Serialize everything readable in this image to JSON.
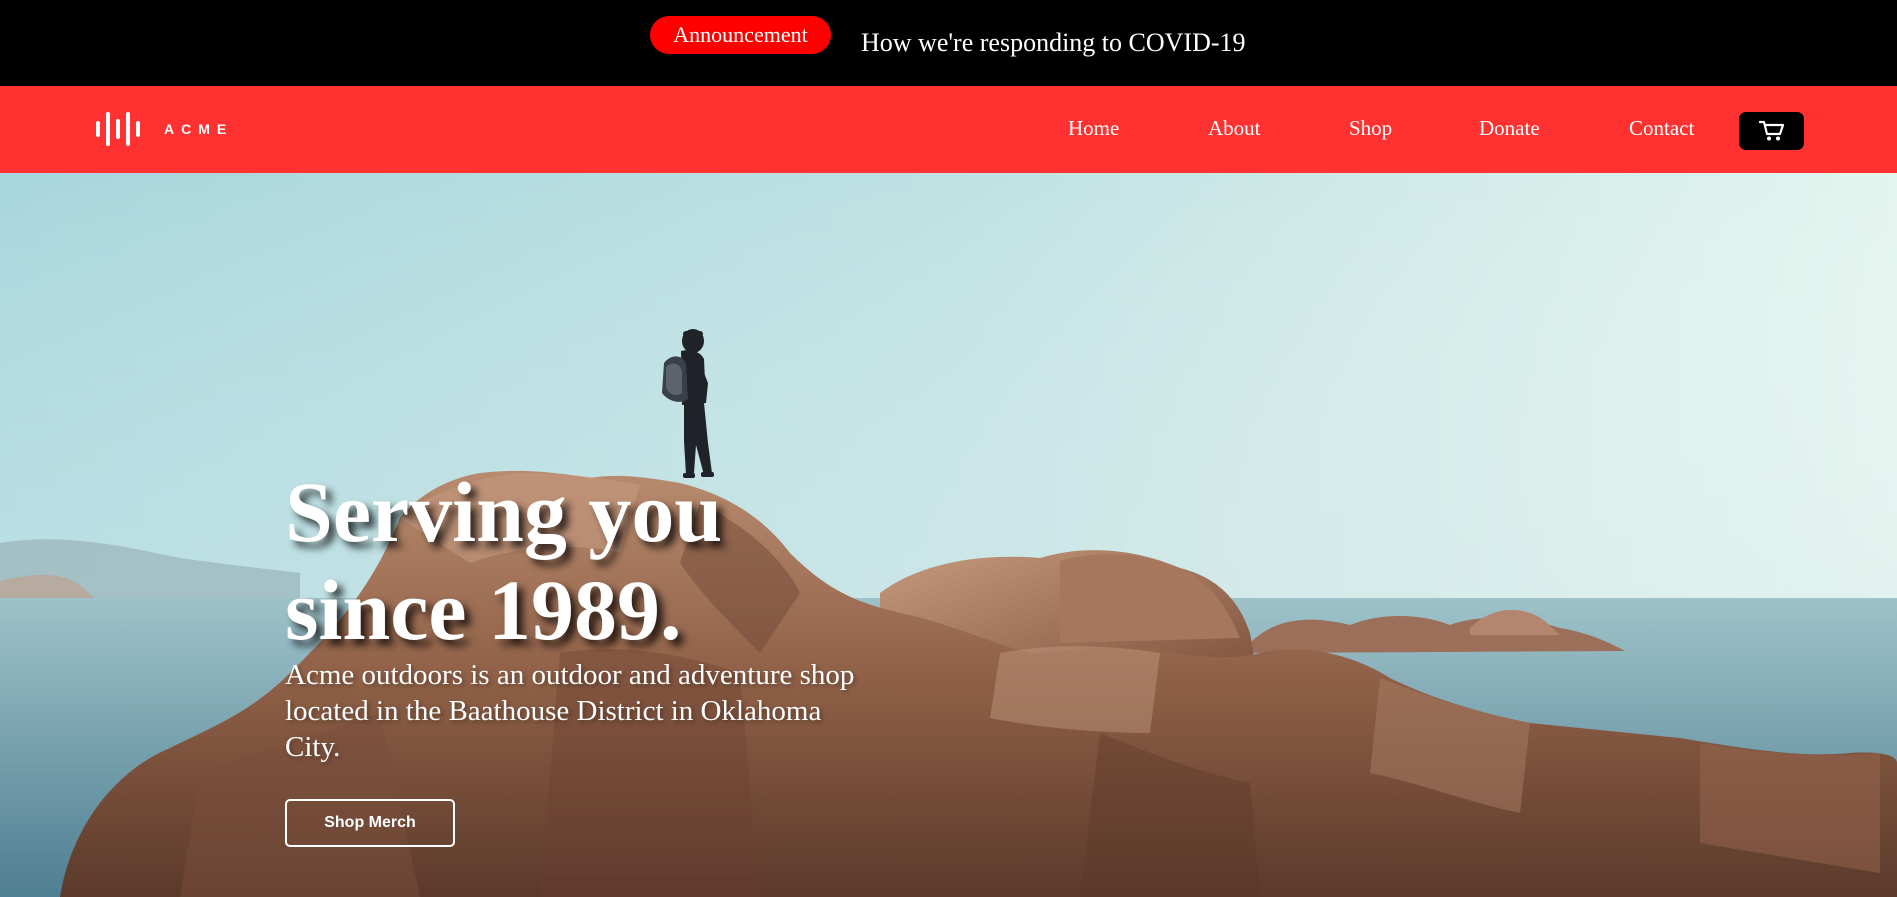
{
  "announcement": {
    "badge_label": "Announcement",
    "message": "How we're responding to COVID-19",
    "badge_color": "#ff0000"
  },
  "nav": {
    "logo_text": "ACME",
    "links": [
      {
        "label": "Home"
      },
      {
        "label": "About"
      },
      {
        "label": "Shop"
      },
      {
        "label": "Donate"
      },
      {
        "label": "Contact"
      }
    ],
    "cart_icon": "shopping-cart-icon",
    "background_color": "#ff3131"
  },
  "hero": {
    "title_line1": "Serving you",
    "title_line2": "since 1989.",
    "description": "Acme outdoors is an outdoor and adventure shop located in the Baathouse District in Oklahoma City.",
    "button_label": "Shop Merch"
  }
}
